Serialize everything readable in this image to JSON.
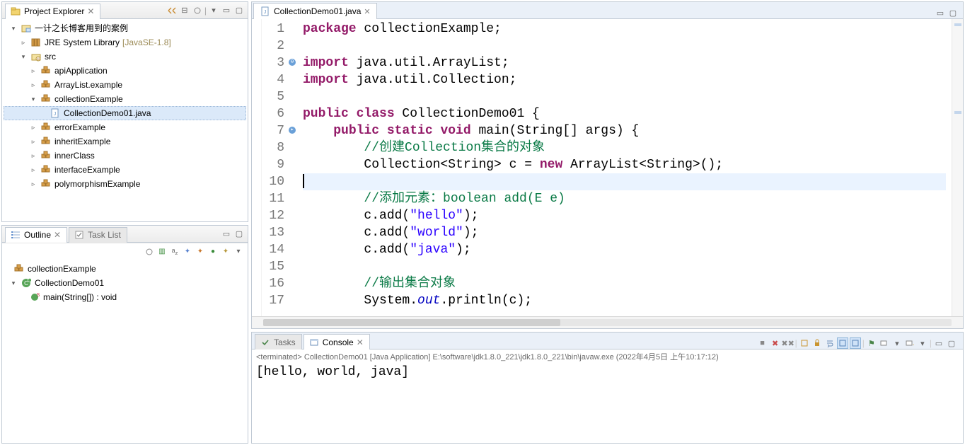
{
  "project_explorer": {
    "title": "Project Explorer",
    "tree": {
      "root": "一计之长博客用到的案例",
      "jre": "JRE System Library",
      "jre_suffix": "[JavaSE-1.8]",
      "src": "src",
      "packages": [
        {
          "name": "apiApplication"
        },
        {
          "name": "ArrayList.example"
        },
        {
          "name": "collectionExample",
          "expanded": true,
          "files": [
            {
              "name": "CollectionDemo01.java"
            }
          ]
        },
        {
          "name": "errorExample"
        },
        {
          "name": "inheritExample"
        },
        {
          "name": "innerClass"
        },
        {
          "name": "interfaceExample"
        },
        {
          "name": "polymorphismExample"
        }
      ]
    }
  },
  "outline": {
    "title": "Outline",
    "task_list_tab": "Task List",
    "package": "collectionExample",
    "class": "CollectionDemo01",
    "method": "main(String[]) : void"
  },
  "editor": {
    "tab_name": "CollectionDemo01.java",
    "lines": [
      {
        "no": 1,
        "code": [
          {
            "t": "package",
            "k": true
          },
          {
            "t": " collectionExample;"
          }
        ]
      },
      {
        "no": 2,
        "code": []
      },
      {
        "no": 3,
        "annot": "import-group",
        "code": [
          {
            "t": "import",
            "k": true
          },
          {
            "t": " java.util.ArrayList;"
          }
        ]
      },
      {
        "no": 4,
        "code": [
          {
            "t": "import",
            "k": true
          },
          {
            "t": " java.util.Collection;"
          }
        ]
      },
      {
        "no": 5,
        "code": []
      },
      {
        "no": 6,
        "code": [
          {
            "t": "public class",
            "k": true
          },
          {
            "t": " CollectionDemo01 {"
          }
        ]
      },
      {
        "no": 7,
        "annot": "method",
        "code": [
          {
            "t": "    "
          },
          {
            "t": "public static void",
            "k": true
          },
          {
            "t": " main(String[] args) {"
          }
        ]
      },
      {
        "no": 8,
        "code": [
          {
            "t": "        "
          },
          {
            "t": "//创建Collection集合的对象",
            "c": true
          }
        ]
      },
      {
        "no": 9,
        "code": [
          {
            "t": "        Collection<String> c = "
          },
          {
            "t": "new",
            "k": true
          },
          {
            "t": " ArrayList<String>();"
          }
        ]
      },
      {
        "no": 10,
        "hl": true,
        "code": [
          {
            "t": ""
          }
        ]
      },
      {
        "no": 11,
        "code": [
          {
            "t": "        "
          },
          {
            "t": "//添加元素：boolean add(E e)",
            "c": true
          }
        ]
      },
      {
        "no": 12,
        "code": [
          {
            "t": "        c.add("
          },
          {
            "t": "\"hello\"",
            "s": true
          },
          {
            "t": ");"
          }
        ]
      },
      {
        "no": 13,
        "code": [
          {
            "t": "        c.add("
          },
          {
            "t": "\"world\"",
            "s": true
          },
          {
            "t": ");"
          }
        ]
      },
      {
        "no": 14,
        "code": [
          {
            "t": "        c.add("
          },
          {
            "t": "\"java\"",
            "s": true
          },
          {
            "t": ");"
          }
        ]
      },
      {
        "no": 15,
        "code": []
      },
      {
        "no": 16,
        "code": [
          {
            "t": "        "
          },
          {
            "t": "//输出集合对象",
            "c": true
          }
        ]
      },
      {
        "no": 17,
        "code": [
          {
            "t": "        System."
          },
          {
            "t": "out",
            "sf": true
          },
          {
            "t": ".println(c);"
          }
        ]
      }
    ]
  },
  "console": {
    "tasks_tab": "Tasks",
    "console_tab": "Console",
    "status": "<terminated> CollectionDemo01 [Java Application] E:\\software\\jdk1.8.0_221\\jdk1.8.0_221\\bin\\javaw.exe (2022年4月5日 上午10:17:12)",
    "output": "[hello, world, java]"
  }
}
